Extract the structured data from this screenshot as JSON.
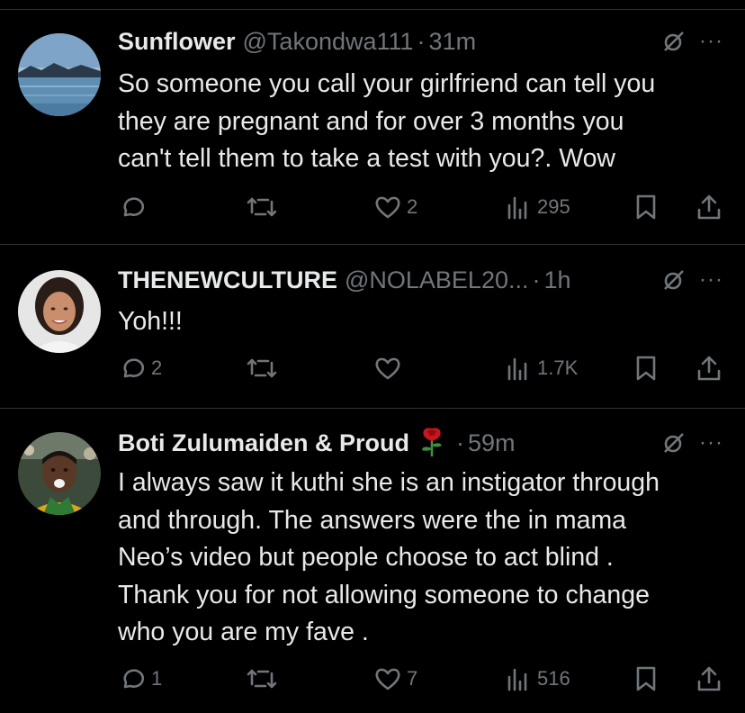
{
  "tweets": [
    {
      "name": "Sunflower",
      "handle": "@Takondwa111",
      "separator": "·",
      "time": "31m",
      "text": "So someone you call your girlfriend can tell you\nthey are pregnant and for over 3 months you\ncan't tell them to take a test with you?. Wow",
      "replies": "",
      "likes": "2",
      "views": "295",
      "avatar": "lake-landscape"
    },
    {
      "name": "THENEWCULTURE",
      "handle": "@NOLABEL20...",
      "separator": "·",
      "time": "1h",
      "text": "Yoh!!!",
      "replies": "2",
      "likes": "",
      "views": "1.7K",
      "avatar": "woman-portrait"
    },
    {
      "name": "Boti Zulumaiden & Proud",
      "handle": "",
      "separator": "·",
      "time": "59m",
      "text": "I always saw it kuthi she is an instigator through\nand through.  The answers were the in mama\nNeo’s video but people choose to act blind .\nThank you for not allowing someone to change\nwho you are my fave .",
      "replies": "1",
      "likes": "7",
      "views": "516",
      "avatar": "man-portrait",
      "emoji": "rose"
    }
  ],
  "more_glyph": "···",
  "colors": {
    "background": "#000000",
    "text": "#e7e9ea",
    "muted": "#71767b",
    "divider": "#2f3336"
  }
}
